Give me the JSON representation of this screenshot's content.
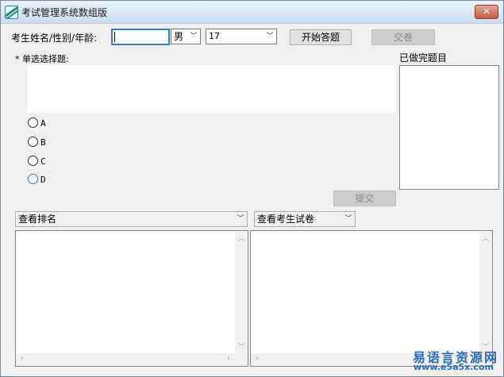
{
  "window": {
    "title": "考试管理系统数组版",
    "close_label": "✕"
  },
  "form": {
    "name_label": "考生姓名/性别/年龄:",
    "name_value": "",
    "gender_value": "男",
    "age_value": "17",
    "start_label": "开始答题",
    "submit_paper_label": "交卷"
  },
  "question": {
    "header": "* 单选选择题:",
    "text": "",
    "options": [
      "A",
      "B",
      "C",
      "D"
    ]
  },
  "done": {
    "label": "已做完题目"
  },
  "submit_label": "提交",
  "ranking": {
    "select_value": "查看排名"
  },
  "paper": {
    "select_value": "查看考生试卷"
  },
  "watermark": {
    "brand": "易语言资源网",
    "url": "www.e5a5x.com"
  }
}
